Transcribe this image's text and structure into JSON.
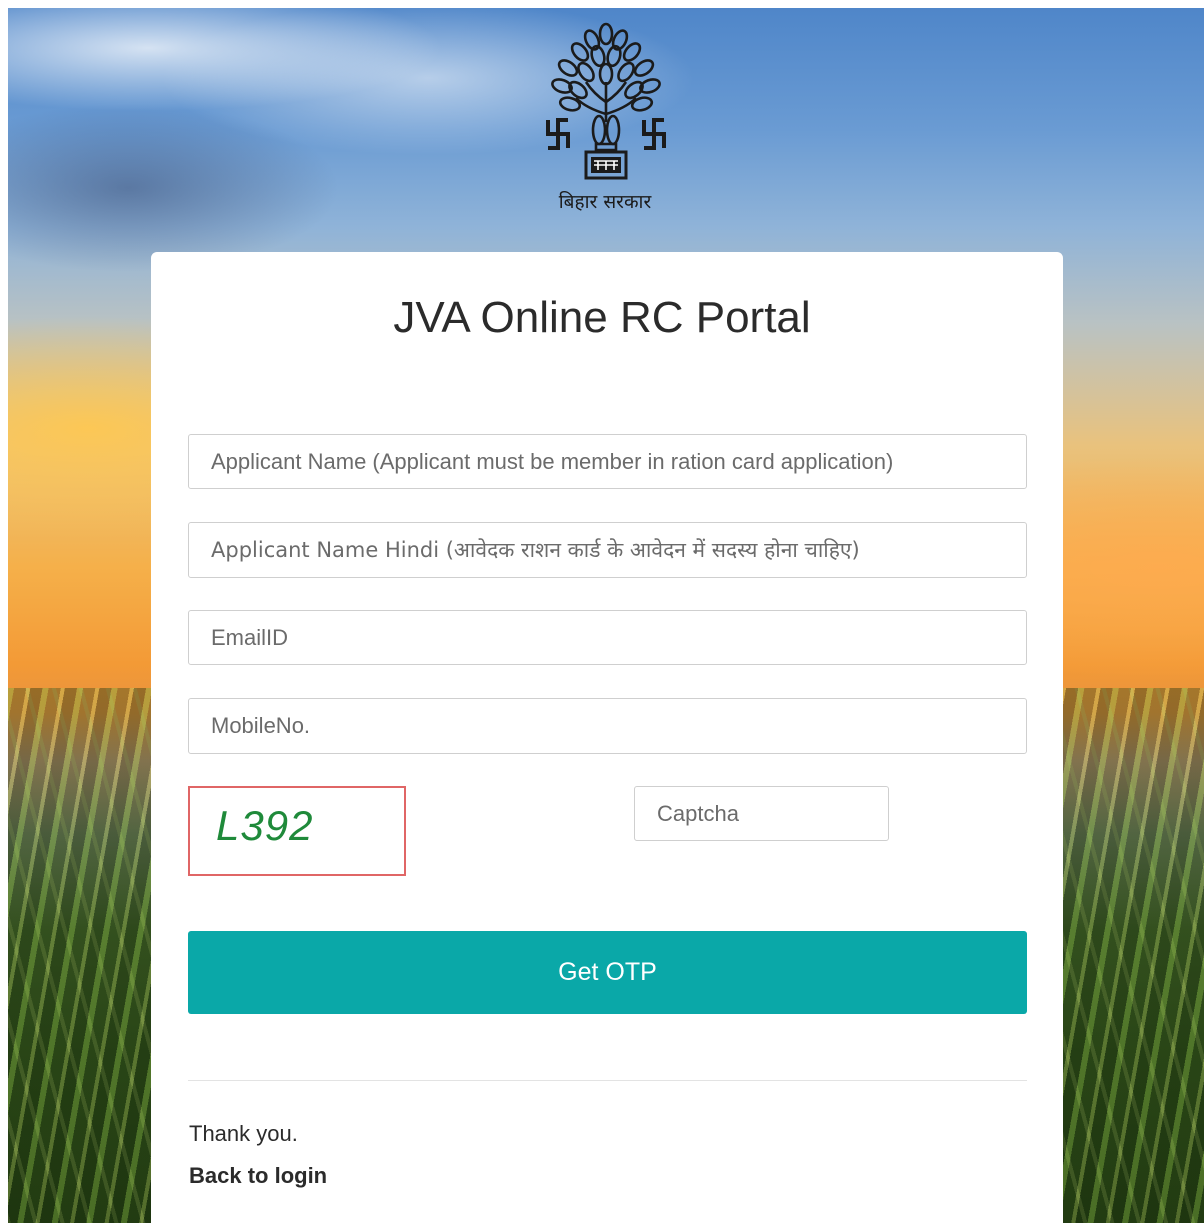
{
  "header": {
    "emblem_icon": "bihar-government-emblem-icon",
    "emblem_caption": "बिहार सरकार"
  },
  "card": {
    "title": "JVA Online RC Portal"
  },
  "form": {
    "applicant_name_placeholder": "Applicant Name (Applicant must be member in ration card application)",
    "applicant_name_hindi_placeholder": "Applicant Name Hindi (आवेदक राशन कार्ड के आवेदन में सदस्य होना चाहिए)",
    "email_placeholder": "EmailID",
    "mobile_placeholder": "MobileNo.",
    "captcha_code": "L392",
    "captcha_placeholder": "Captcha",
    "get_otp_label": "Get OTP"
  },
  "footer": {
    "thanks_text": "Thank you.",
    "back_link": "Back to login"
  },
  "colors": {
    "button_bg": "#0aa8a8",
    "captcha_text": "#1f8a3a",
    "captcha_border": "#e06666"
  }
}
